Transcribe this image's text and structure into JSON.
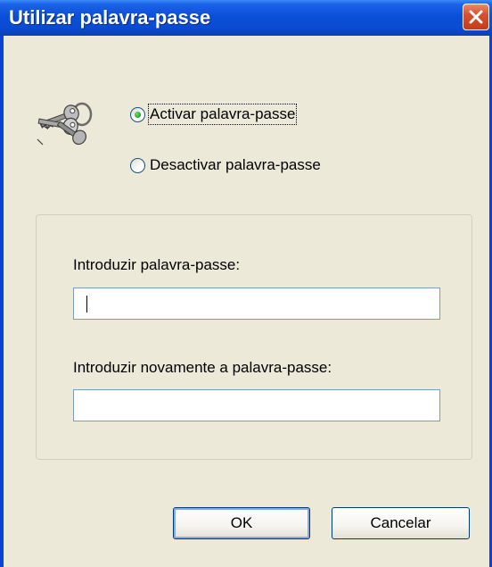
{
  "window": {
    "title": "Utilizar palavra-passe",
    "close_icon": "close-icon"
  },
  "icon": {
    "name": "keys-icon"
  },
  "options": {
    "enable_label": "Activar palavra-passe",
    "disable_label": "Desactivar palavra-passe",
    "selected": "enable"
  },
  "form": {
    "password_label": "Introduzir palavra-passe:",
    "password_value": "",
    "confirm_label": "Introduzir novamente a palavra-passe:",
    "confirm_value": ""
  },
  "buttons": {
    "ok_label": "OK",
    "cancel_label": "Cancelar"
  }
}
